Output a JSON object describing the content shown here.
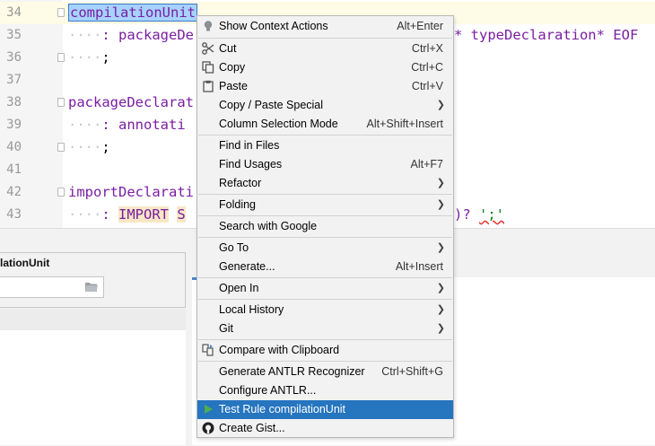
{
  "editor": {
    "lines": [
      {
        "n": "34"
      },
      {
        "n": "35"
      },
      {
        "n": "36"
      },
      {
        "n": "37"
      },
      {
        "n": "38"
      },
      {
        "n": "39"
      },
      {
        "n": "40"
      },
      {
        "n": "41"
      },
      {
        "n": "42"
      },
      {
        "n": "43"
      }
    ],
    "code": {
      "l34_rule": "compilationUnit",
      "l35_a": ": packageDe",
      "l35_b": "* typeDeclaration* EOF",
      "l36": ";",
      "l38_rule": "packageDeclarat",
      "l39": ": annotati",
      "l40": ";",
      "l42_rule": "importDeclarati",
      "l43_colon": ": ",
      "l43_kw": "IMPORT",
      "l43_s": "S",
      "l43_tail": ")? ",
      "l43_lit": "';'"
    }
  },
  "panel": {
    "title": "lationUnit"
  },
  "menu": {
    "items": [
      {
        "label": "Show Context Actions",
        "shortcut": "Alt+Enter",
        "icon": "lightbulb-icon"
      },
      {
        "label": "Cut",
        "shortcut": "Ctrl+X",
        "icon": "scissors-icon"
      },
      {
        "label": "Copy",
        "shortcut": "Ctrl+C",
        "icon": "copy-icon"
      },
      {
        "label": "Paste",
        "shortcut": "Ctrl+V",
        "icon": "clipboard-icon"
      },
      {
        "label": "Copy / Paste Special",
        "submenu": true
      },
      {
        "label": "Column Selection Mode",
        "shortcut": "Alt+Shift+Insert"
      },
      {
        "label": "Find in Files"
      },
      {
        "label": "Find Usages",
        "shortcut": "Alt+F7"
      },
      {
        "label": "Refactor",
        "submenu": true
      },
      {
        "label": "Folding",
        "submenu": true
      },
      {
        "label": "Search with Google"
      },
      {
        "label": "Go To",
        "submenu": true
      },
      {
        "label": "Generate...",
        "shortcut": "Alt+Insert"
      },
      {
        "label": "Open In",
        "submenu": true
      },
      {
        "label": "Local History",
        "submenu": true
      },
      {
        "label": "Git",
        "submenu": true
      },
      {
        "label": "Compare with Clipboard",
        "icon": "compare-icon"
      },
      {
        "label": "Generate ANTLR Recognizer",
        "shortcut": "Ctrl+Shift+G"
      },
      {
        "label": "Configure ANTLR..."
      },
      {
        "label": "Test Rule compilationUnit",
        "icon": "run-icon",
        "highlighted": true
      },
      {
        "label": "Create Gist...",
        "icon": "github-icon"
      }
    ]
  },
  "colors": {
    "highlight": "#2675bf",
    "rule": "#7a1ea0",
    "selection": "#a6d2ff"
  }
}
